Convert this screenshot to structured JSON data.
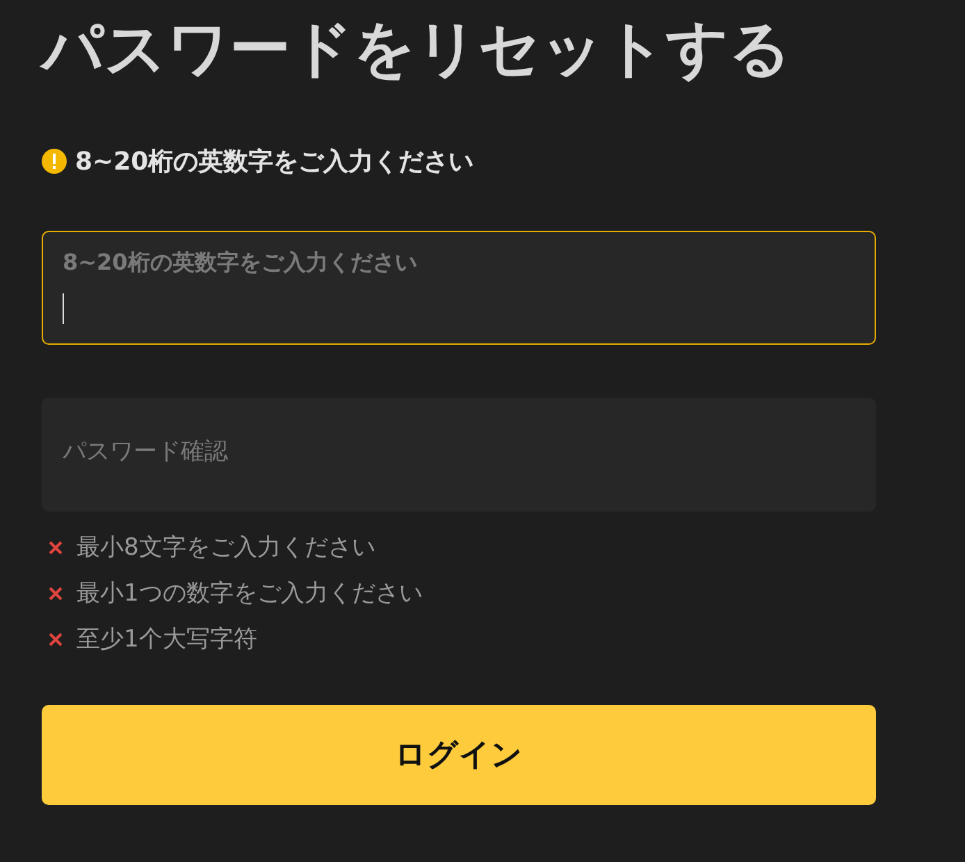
{
  "title": "パスワードをリセットする",
  "hint": {
    "text": "8~20桁の英数字をご入力ください"
  },
  "fields": [
    {
      "label": "8~20桁の英数字をご入力ください",
      "focused": true
    },
    {
      "placeholder": "パスワード確認",
      "focused": false
    }
  ],
  "rules": [
    {
      "text": "最小8文字をご入力ください",
      "met": false
    },
    {
      "text": "最小1つの数字をご入力ください",
      "met": false
    },
    {
      "text": "至少1个大写字符",
      "met": false
    }
  ],
  "button": {
    "label": "ログイン"
  }
}
